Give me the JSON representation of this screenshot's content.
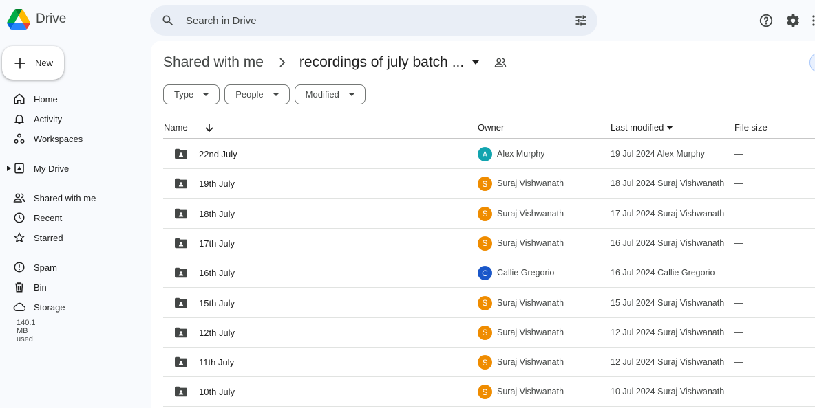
{
  "app": {
    "name": "Drive"
  },
  "search": {
    "placeholder": "Search in Drive"
  },
  "sidebar": {
    "new_label": "New",
    "items": [
      {
        "label": "Home",
        "icon": "home-icon"
      },
      {
        "label": "Activity",
        "icon": "bell-icon"
      },
      {
        "label": "Workspaces",
        "icon": "workspaces-icon"
      },
      {
        "label": "My Drive",
        "icon": "my-drive-icon"
      },
      {
        "label": "Shared with me",
        "icon": "people-icon"
      },
      {
        "label": "Recent",
        "icon": "clock-icon"
      },
      {
        "label": "Starred",
        "icon": "star-icon"
      },
      {
        "label": "Spam",
        "icon": "spam-icon"
      },
      {
        "label": "Bin",
        "icon": "trash-icon"
      },
      {
        "label": "Storage",
        "icon": "cloud-icon"
      }
    ],
    "storage_used": "140.1 MB used"
  },
  "breadcrumb": {
    "parent": "Shared with me",
    "current": "recordings of july batch ..."
  },
  "filters": [
    "Type",
    "People",
    "Modified"
  ],
  "table": {
    "headers": {
      "name": "Name",
      "owner": "Owner",
      "modified": "Last modified",
      "size": "File size"
    },
    "rows": [
      {
        "name": "22nd July",
        "avatar": "A",
        "avatar_color": "#12a4af",
        "owner": "Alex Murphy",
        "modified": "19 Jul 2024  Alex Murphy",
        "size": "—"
      },
      {
        "name": "19th July",
        "avatar": "S",
        "avatar_color": "#ef8c00",
        "owner": "Suraj Vishwanath",
        "modified": "18 Jul 2024  Suraj Vishwanath",
        "size": "—"
      },
      {
        "name": "18th July",
        "avatar": "S",
        "avatar_color": "#ef8c00",
        "owner": "Suraj Vishwanath",
        "modified": "17 Jul 2024  Suraj Vishwanath",
        "size": "—"
      },
      {
        "name": "17th July",
        "avatar": "S",
        "avatar_color": "#ef8c00",
        "owner": "Suraj Vishwanath",
        "modified": "16 Jul 2024  Suraj Vishwanath",
        "size": "—"
      },
      {
        "name": "16th July",
        "avatar": "C",
        "avatar_color": "#1a57c9",
        "owner": "Callie Gregorio",
        "modified": "16 Jul 2024  Callie Gregorio",
        "size": "—"
      },
      {
        "name": "15th July",
        "avatar": "S",
        "avatar_color": "#ef8c00",
        "owner": "Suraj Vishwanath",
        "modified": "15 Jul 2024  Suraj Vishwanath",
        "size": "—"
      },
      {
        "name": "12th July",
        "avatar": "S",
        "avatar_color": "#ef8c00",
        "owner": "Suraj Vishwanath",
        "modified": "12 Jul 2024  Suraj Vishwanath",
        "size": "—"
      },
      {
        "name": "11th July",
        "avatar": "S",
        "avatar_color": "#ef8c00",
        "owner": "Suraj Vishwanath",
        "modified": "12 Jul 2024  Suraj Vishwanath",
        "size": "—"
      },
      {
        "name": "10th July",
        "avatar": "S",
        "avatar_color": "#ef8c00",
        "owner": "Suraj Vishwanath",
        "modified": "10 Jul 2024  Suraj Vishwanath",
        "size": "—"
      }
    ]
  },
  "colors": {
    "surface": "#f8fafd",
    "search_bg": "#e9eef6",
    "panel": "#ffffff"
  }
}
